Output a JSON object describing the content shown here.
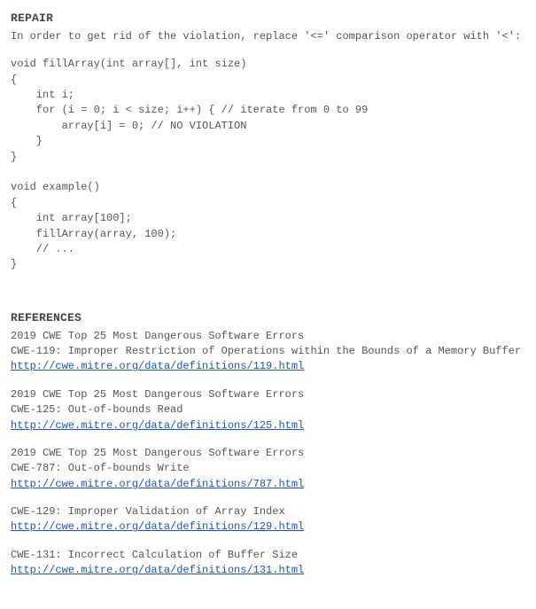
{
  "repair": {
    "heading": "REPAIR",
    "intro": "In order to get rid of the violation, replace '<=' comparison operator with '<':",
    "code": "void fillArray(int array[], int size)\n{\n    int i;\n    for (i = 0; i < size; i++) { // iterate from 0 to 99\n        array[i] = 0; // NO VIOLATION\n    }\n}\n\nvoid example()\n{\n    int array[100];\n    fillArray(array, 100);\n    // ...\n}"
  },
  "references": {
    "heading": "REFERENCES",
    "items": [
      {
        "line1": "2019 CWE Top 25 Most Dangerous Software Errors",
        "line2": "CWE-119: Improper Restriction of Operations within the Bounds of a Memory Buffer",
        "link": "http://cwe.mitre.org/data/definitions/119.html"
      },
      {
        "line1": "2019 CWE Top 25 Most Dangerous Software Errors",
        "line2": "CWE-125: Out-of-bounds Read",
        "link": "http://cwe.mitre.org/data/definitions/125.html"
      },
      {
        "line1": "2019 CWE Top 25 Most Dangerous Software Errors",
        "line2": "CWE-787: Out-of-bounds Write",
        "link": "http://cwe.mitre.org/data/definitions/787.html"
      },
      {
        "line1": "",
        "line2": "CWE-129: Improper Validation of Array Index",
        "link": "http://cwe.mitre.org/data/definitions/129.html"
      },
      {
        "line1": "",
        "line2": "CWE-131: Incorrect Calculation of Buffer Size",
        "link": "http://cwe.mitre.org/data/definitions/131.html"
      }
    ]
  }
}
